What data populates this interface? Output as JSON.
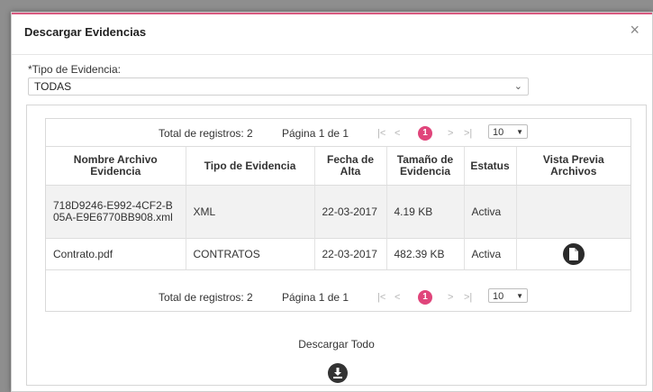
{
  "dialog": {
    "title": "Descargar Evidencias",
    "close_label": "×"
  },
  "filter": {
    "label": "*Tipo de Evidencia:",
    "selected": "TODAS"
  },
  "pager": {
    "total": "Total de registros: 2",
    "page": "Página 1 de 1",
    "current_page": "1",
    "page_size": "10",
    "first": "|<",
    "prev": "<",
    "next": ">",
    "last": ">|"
  },
  "table": {
    "headers": [
      "Nombre Archivo Evidencia",
      "Tipo de Evidencia",
      "Fecha de Alta",
      "Tamaño de Evidencia",
      "Estatus",
      "Vista Previa Archivos"
    ],
    "rows": [
      {
        "name": "718D9246-E992-4CF2-B05A-E9E6770BB908.xml",
        "type": "XML",
        "date": "22-03-2017",
        "size": "4.19 KB",
        "status": "Activa",
        "preview": false
      },
      {
        "name": "Contrato.pdf",
        "type": "CONTRATOS",
        "date": "22-03-2017",
        "size": "482.39 KB",
        "status": "Activa",
        "preview": true
      }
    ]
  },
  "download": {
    "label": "Descargar Todo"
  },
  "colors": {
    "accent": "#e0457b",
    "icon_dark": "#2b2b2b"
  }
}
